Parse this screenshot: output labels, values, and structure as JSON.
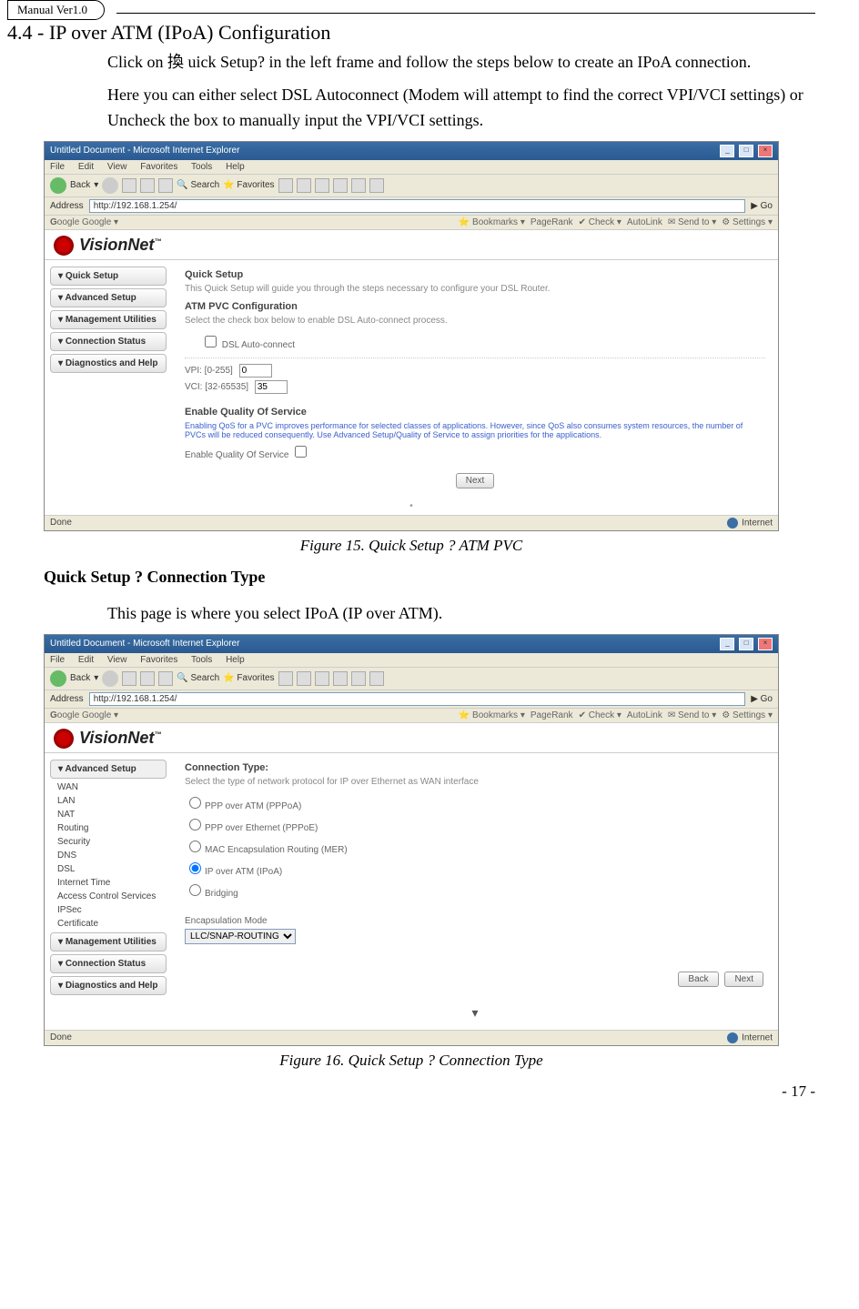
{
  "header": {
    "manual_version": "Manual Ver1.0"
  },
  "section": {
    "number": "4.4",
    "title": "IP over ATM (IPoA) Configuration",
    "para1": "Click on 換 uick Setup? in the left frame and follow the steps below to create an IPoA connection.",
    "para2": "Here you can either select DSL Autoconnect (Modem will attempt to find the correct VPI/VCI settings) or Uncheck the box to manually input the VPI/VCI settings."
  },
  "figure15": {
    "caption": "Figure 15. Quick Setup ? ATM PVC"
  },
  "subheading": "Quick Setup ? Connection Type",
  "para3": "This page is where you select IPoA (IP over ATM).",
  "figure16": {
    "caption": "Figure 16. Quick Setup ? Connection Type"
  },
  "page_number": "- 17 -",
  "browser": {
    "title": "Untitled Document - Microsoft Internet Explorer",
    "menu": [
      "File",
      "Edit",
      "View",
      "Favorites",
      "Tools",
      "Help"
    ],
    "back": "Back",
    "search": "Search",
    "favorites": "Favorites",
    "address_label": "Address",
    "address_value": "http://192.168.1.254/",
    "go": "Go",
    "google_label": "Google",
    "google_items": [
      "Bookmarks",
      "PageRank",
      "Check",
      "AutoLink",
      "Send to",
      "Settings"
    ],
    "status_done": "Done",
    "status_internet": "Internet"
  },
  "logo": {
    "brand": "VisionNet",
    "tm": "™"
  },
  "sidebar_a": {
    "items": [
      "Quick Setup",
      "Advanced Setup",
      "Management Utilities",
      "Connection Status",
      "Diagnostics and Help"
    ]
  },
  "quick_setup_panel": {
    "title": "Quick Setup",
    "intro": "This Quick Setup will guide you through the steps necessary to configure your DSL Router.",
    "atm_heading": "ATM PVC Configuration",
    "atm_desc": "Select the check box below to enable DSL Auto-connect process.",
    "auto_label": "DSL Auto-connect",
    "vpi_label": "VPI: [0-255]",
    "vpi_value": "0",
    "vci_label": "VCI: [32-65535]",
    "vci_value": "35",
    "qos_heading": "Enable Quality Of Service",
    "qos_note": "Enabling QoS for a PVC improves performance for selected classes of applications. However, since QoS also consumes system resources, the number of PVCs will be reduced consequently. Use Advanced Setup/Quality of Service to assign priorities for the applications.",
    "qos_label": "Enable Quality Of Service",
    "next_btn": "Next"
  },
  "sidebar_b": {
    "top": "Advanced Setup",
    "subs": [
      "WAN",
      "LAN",
      "NAT",
      "Routing",
      "Security",
      "DNS",
      "DSL",
      "Internet Time",
      "Access Control Services",
      "IPSec",
      "Certificate"
    ],
    "items": [
      "Management Utilities",
      "Connection Status",
      "Diagnostics and Help"
    ]
  },
  "conn_type_panel": {
    "title": "Connection Type:",
    "desc": "Select the type of network protocol for IP over Ethernet as WAN interface",
    "opt1": "PPP over ATM (PPPoA)",
    "opt2": "PPP over Ethernet (PPPoE)",
    "opt3": "MAC Encapsulation Routing (MER)",
    "opt4": "IP over ATM (IPoA)",
    "opt5": "Bridging",
    "encap_label": "Encapsulation Mode",
    "encap_value": "LLC/SNAP-ROUTING",
    "back_btn": "Back",
    "next_btn": "Next"
  }
}
